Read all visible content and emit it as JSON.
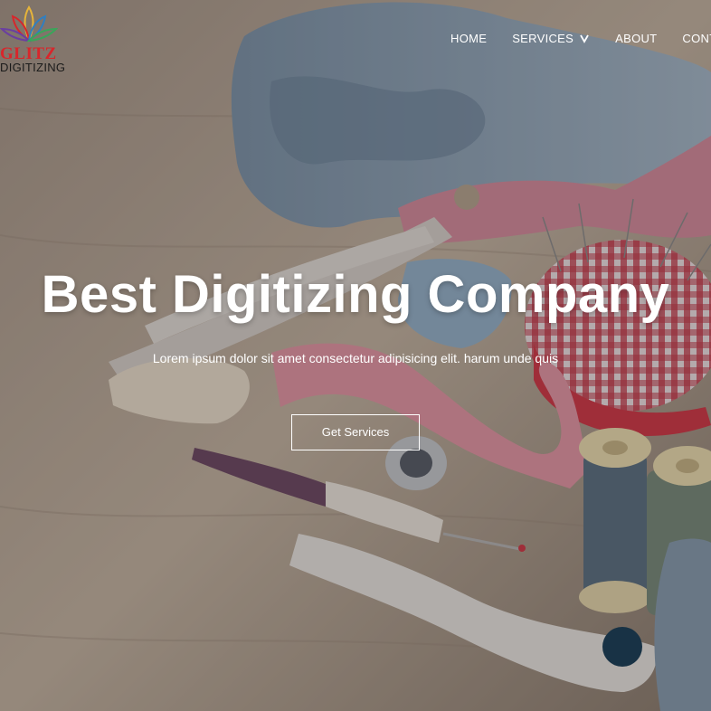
{
  "logo": {
    "word": "GLITZ",
    "sub": "DIGITIZING"
  },
  "nav": {
    "items": [
      {
        "label": "HOME"
      },
      {
        "label": "SERVICES"
      },
      {
        "label": "ABOUT"
      },
      {
        "label": "CONTACT"
      }
    ]
  },
  "hero": {
    "title": "Best Digitizing Company",
    "subtitle": "Lorem ipsum dolor sit amet consectetur adipisicing elit. harum unde quis",
    "cta_label": "Get Services"
  },
  "colors": {
    "logo_red": "#d8262b",
    "text_white": "#ffffff"
  },
  "icons": {
    "services_dropdown": "chevron-down-icon",
    "logo_mark": "lotus-icon"
  }
}
